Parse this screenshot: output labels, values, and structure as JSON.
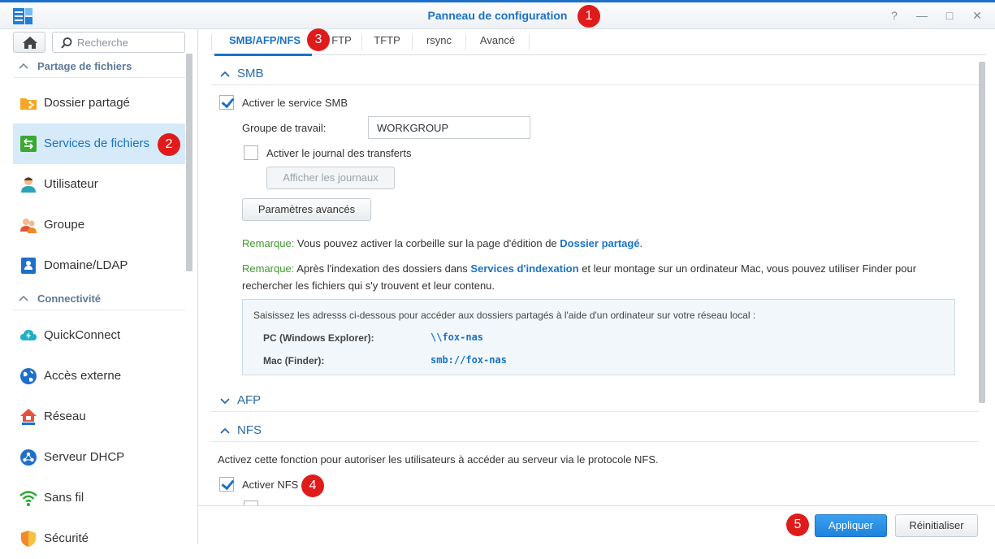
{
  "window": {
    "title": "Panneau de configuration",
    "controls": [
      "?",
      "—",
      "□",
      "✕"
    ]
  },
  "sidebar": {
    "search_placeholder": "Recherche",
    "sections": [
      {
        "label": "Partage de fichiers",
        "items": [
          {
            "label": "Dossier partagé",
            "icon": "shared-folder-icon"
          },
          {
            "label": "Services de fichiers",
            "icon": "file-services-icon",
            "active": true
          },
          {
            "label": "Utilisateur",
            "icon": "user-icon"
          },
          {
            "label": "Groupe",
            "icon": "group-icon"
          },
          {
            "label": "Domaine/LDAP",
            "icon": "domain-ldap-icon"
          }
        ]
      },
      {
        "label": "Connectivité",
        "items": [
          {
            "label": "QuickConnect",
            "icon": "quickconnect-icon"
          },
          {
            "label": "Accès externe",
            "icon": "external-access-icon"
          },
          {
            "label": "Réseau",
            "icon": "network-icon"
          },
          {
            "label": "Serveur DHCP",
            "icon": "dhcp-server-icon"
          },
          {
            "label": "Sans fil",
            "icon": "wireless-icon"
          },
          {
            "label": "Sécurité",
            "icon": "security-icon"
          }
        ]
      }
    ]
  },
  "tabs": [
    "SMB/AFP/NFS",
    "FTP",
    "TFTP",
    "rsync",
    "Avancé"
  ],
  "smb": {
    "title": "SMB",
    "enable_label": "Activer le service SMB",
    "enable_checked": true,
    "workgroup_label": "Groupe de travail:",
    "workgroup_value": "WORKGROUP",
    "log_label": "Activer le journal des transferts",
    "log_checked": false,
    "show_logs_button": "Afficher les journaux",
    "advanced_button": "Paramètres avancés",
    "note1_prefix": "Remarque:",
    "note1_text": " Vous pouvez activer la corbeille sur la page d'édition de ",
    "note1_link": "Dossier partagé",
    "note1_end": ".",
    "note2_prefix": "Remarque:",
    "note2_text": " Après l'indexation des dossiers dans ",
    "note2_link": "Services d'indexation",
    "note2_text2": " et leur montage sur un ordinateur Mac, vous pouvez utiliser Finder pour",
    "note2_line2": "rechercher les fichiers qui s'y trouvent et leur contenu.",
    "info_intro": "Saisissez les adresss ci-dessous pour accéder aux dossiers partagés à l'aide d'un ordinateur sur votre réseau local :",
    "pc_label": "PC (Windows Explorer):",
    "pc_value": "\\\\fox-nas",
    "mac_label": "Mac (Finder):",
    "mac_value": "smb://fox-nas"
  },
  "afp": {
    "title": "AFP"
  },
  "nfs": {
    "title": "NFS",
    "description": "Activez cette fonction pour autoriser les utilisateurs à accéder au serveur via le protocole NFS.",
    "enable_label": "Activer NFS",
    "enable_checked": true
  },
  "footer": {
    "apply_button": "Appliquer",
    "reset_button": "Réinitialiser"
  },
  "badges": [
    "1",
    "2",
    "3",
    "4",
    "5"
  ],
  "colors": {
    "accent": "#1a73c6",
    "badge": "#e01b1b",
    "note_green": "#3d9a2c",
    "active_bg": "#d6eaf9"
  }
}
